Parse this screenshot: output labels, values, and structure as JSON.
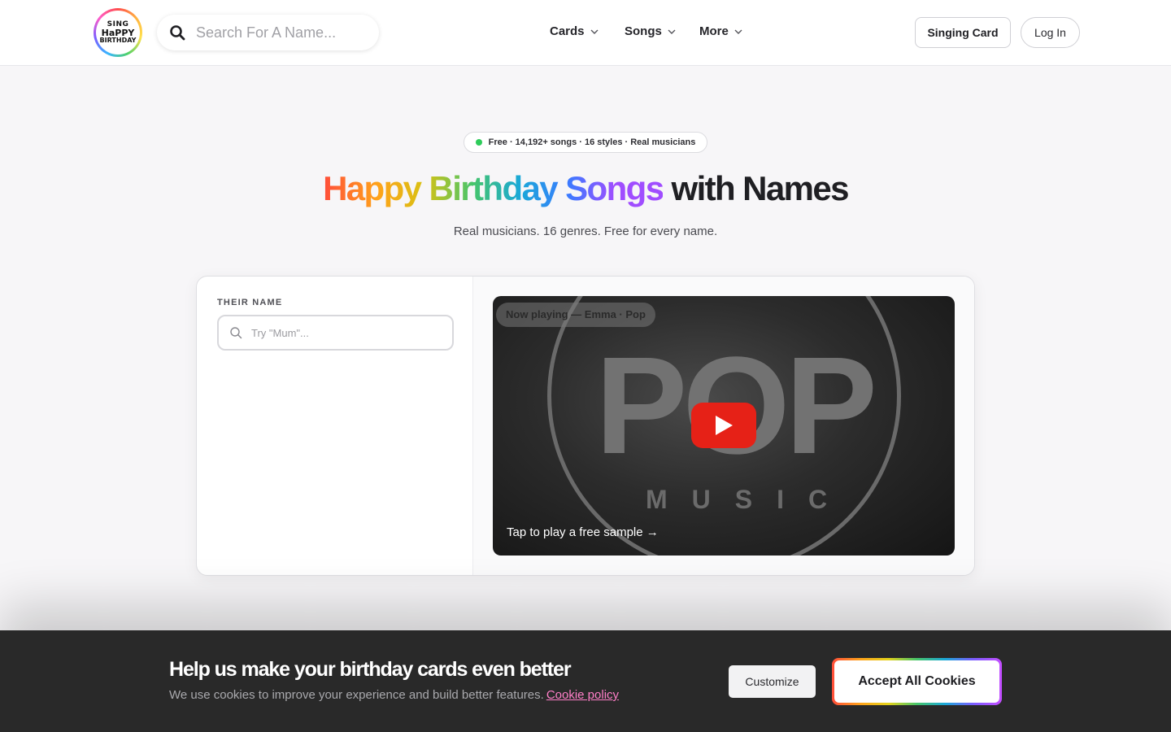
{
  "header": {
    "logo": {
      "line1": "SING",
      "line2": "HaPPY",
      "line3": "BIRTHDAY"
    },
    "search": {
      "placeholder": "Search For A Name..."
    },
    "nav": [
      {
        "label": "Cards"
      },
      {
        "label": "Songs"
      },
      {
        "label": "More"
      }
    ],
    "singing_card_label": "Singing Card",
    "login_label": "Log In"
  },
  "hero": {
    "badge": "Free · 14,192+ songs · 16 styles · Real musicians",
    "title_colored": "Happy Birthday Songs",
    "title_rest": " with Names",
    "subtitle": "Real musicians. 16 genres. Free for every name."
  },
  "card": {
    "name_label": "THEIR NAME",
    "name_placeholder": "Try \"Mum\"...",
    "video": {
      "now_playing": "Now playing — Emma · Pop",
      "logo_word": "POP",
      "logo_sub": "MUSIC",
      "tap_text": "Tap to play a free sample →"
    }
  },
  "cookie": {
    "title": "Help us make your birthday cards even better",
    "text": "We use cookies to improve your experience and build better features.",
    "policy_link": "Cookie policy",
    "customize_label": "Customize",
    "accept_label": "Accept All Cookies"
  },
  "colors": {
    "accent_red": "#e62117",
    "status_green": "#2ecc5a",
    "link_pink": "#ff7fc8",
    "cookie_bg": "#292929"
  }
}
